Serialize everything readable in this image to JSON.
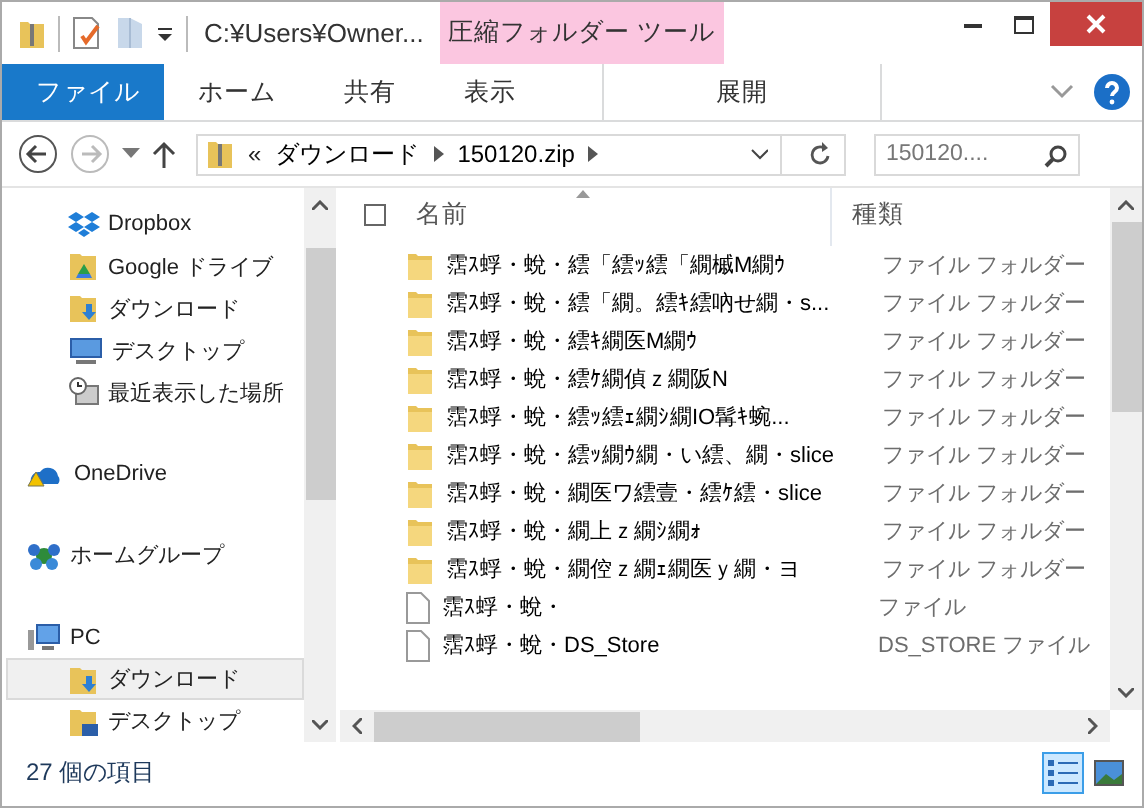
{
  "title_bar": {
    "path": "C:¥Users¥Owner...",
    "context_tab": "圧縮フォルダー ツール"
  },
  "ribbon_tabs": [
    {
      "label": "ファイル",
      "kind": "file"
    },
    {
      "label": "ホーム",
      "kind": "tab"
    },
    {
      "label": "共有",
      "kind": "tab"
    },
    {
      "label": "表示",
      "kind": "tab"
    },
    {
      "label": "展開",
      "kind": "context"
    }
  ],
  "address": {
    "prefix": "«",
    "crumbs": [
      "ダウンロード",
      "150120.zip"
    ],
    "search_placeholder": "150120...."
  },
  "nav": {
    "sections": [
      {
        "children": [
          {
            "label": "Dropbox",
            "kind": "dropbox",
            "selected": false
          },
          {
            "label": "Google ドライブ",
            "kind": "gdrive",
            "selected": false
          },
          {
            "label": "ダウンロード",
            "kind": "download",
            "selected": false
          },
          {
            "label": "デスクトップ",
            "kind": "desktop",
            "selected": false
          },
          {
            "label": "最近表示した場所",
            "kind": "recent",
            "selected": false
          }
        ]
      },
      {
        "label": "OneDrive",
        "kind": "onedrive",
        "selected": false
      },
      {
        "label": "ホームグループ",
        "kind": "homegroup",
        "selected": false
      },
      {
        "label": "PC",
        "kind": "pc",
        "selected": false,
        "children": [
          {
            "label": "ダウンロード",
            "kind": "download",
            "selected": true
          },
          {
            "label": "デスクトップ",
            "kind": "deskfolder",
            "selected": false
          }
        ]
      }
    ]
  },
  "files": {
    "select_all_checked": false,
    "columns": [
      "名前",
      "種類"
    ],
    "rows": [
      {
        "name": "霑ｽ蜉・蛻・繧「繧ｯ繧「繝槭M繝ｳ",
        "type": "ファイル フォルダー",
        "kind": "folder"
      },
      {
        "name": "霑ｽ蜉・蛻・繧「繝。繧ｷ繧吶せ繝・s...",
        "type": "ファイル フォルダー",
        "kind": "folder"
      },
      {
        "name": "霑ｽ蜉・蛻・繧ｷ繝医M繝ｳ",
        "type": "ファイル フォルダー",
        "kind": "folder"
      },
      {
        "name": "霑ｽ蜉・蛻・繧ｹ繝偵ｚ繝阪N",
        "type": "ファイル フォルダー",
        "kind": "folder"
      },
      {
        "name": "霑ｽ蜉・蛻・繧ｯ繧ｪ繝ｼ繝IO髯ｷ蜿...",
        "type": "ファイル フォルダー",
        "kind": "folder"
      },
      {
        "name": "霑ｽ蜉・蛻・繧ｯ繝ｳ繝・い繧、繝・slice",
        "type": "ファイル フォルダー",
        "kind": "folder"
      },
      {
        "name": "霑ｽ蜉・蛻・繝医ワ繧壹・繧ｹ繧・slice",
        "type": "ファイル フォルダー",
        "kind": "folder"
      },
      {
        "name": "霑ｽ蜉・蛻・繝上ｚ繝ｼ繝ｫ",
        "type": "ファイル フォルダー",
        "kind": "folder"
      },
      {
        "name": "霑ｽ蜉・蛻・繝倥ｚ繝ｪ繝医ｙ繝・ヨ",
        "type": "ファイル フォルダー",
        "kind": "folder"
      },
      {
        "name": "霑ｽ蜉・蛻・",
        "type": "ファイル",
        "kind": "file"
      },
      {
        "name": "霑ｽ蜉・蛻・DS_Store",
        "type": "DS_STORE ファイル",
        "kind": "file"
      }
    ]
  },
  "status_bar": {
    "count": "27 個の項目",
    "views": [
      {
        "kind": "details",
        "selected": true
      },
      {
        "kind": "thumbnails",
        "selected": false
      }
    ]
  }
}
